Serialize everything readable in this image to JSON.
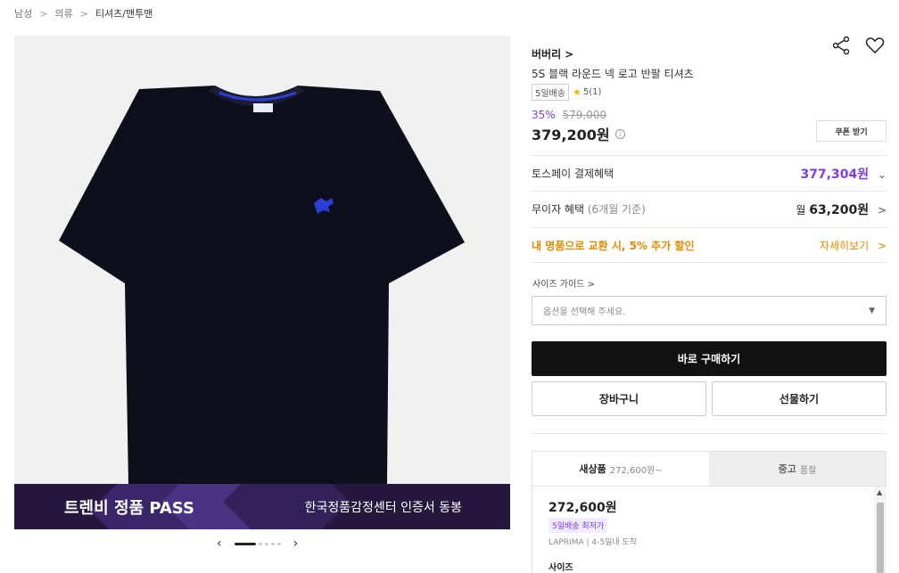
{
  "breadcrumb": [
    "남성",
    "의류",
    "티셔츠/맨투맨"
  ],
  "gallery": {
    "banner_left": "트렌비 정품 PASS",
    "banner_right": "한국정품감정센터 인증서 동봉"
  },
  "product": {
    "brand": "버버리",
    "name": "5S 블랙 라운드 넥 로고 반팔 티셔츠",
    "delivery_tag": "5일배송",
    "rating": "5(1)",
    "discount_pct": "35%",
    "original_price": "579,000",
    "price": "379,200원",
    "coupon_label": "쿠폰 받기"
  },
  "benefits": {
    "toss_label": "토스페이 결제혜택",
    "toss_value": "377,304원",
    "installment_label": "무이자 혜택",
    "installment_sub": "(6개월 기준)",
    "installment_prefix": "월",
    "installment_value": "63,200원",
    "trade_label": "내 명품으로 교환 시, 5% 추가 할인",
    "trade_link": "자세히보기"
  },
  "options": {
    "size_guide": "사이즈 가이드",
    "select_placeholder": "옵션을 선택해 주세요."
  },
  "actions": {
    "buy": "바로 구매하기",
    "cart": "장바구니",
    "gift": "선물하기"
  },
  "tabs": {
    "new_label": "새상품",
    "new_sub": "272,600원~",
    "used_label": "중고",
    "used_sub": "품절"
  },
  "offer": {
    "price": "272,600원",
    "badge": "5일배송 최저가",
    "seller": "LAPRIMA  |  4-5일내 도착",
    "size_label": "사이즈"
  },
  "colors": {
    "accent_purple": "#7c3fe4",
    "accent_orange": "#e58a00",
    "logo_blue": "#2b3fd6"
  }
}
